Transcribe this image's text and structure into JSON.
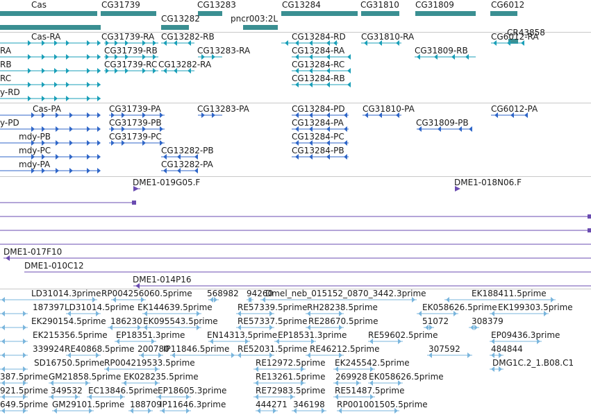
{
  "colors": {
    "gene": "#3a8f92",
    "mrna": "#1a9fb8",
    "protein": "#2f66c8",
    "clone": "#6a4bb0",
    "est": "#7ab6dd",
    "separator": "#c8c8c8"
  },
  "genes_track": {
    "features": [
      {
        "label": "Cas",
        "style": "gene"
      },
      {
        "label": "CG31739",
        "style": "gene"
      },
      {
        "label": "CG13283",
        "style": "gene"
      },
      {
        "label": "CG13284",
        "style": "gene"
      },
      {
        "label": "CG31810",
        "style": "gene"
      },
      {
        "label": "CG31809",
        "style": "gene"
      },
      {
        "label": "CG6012",
        "style": "gene"
      },
      {
        "label": "CG13282",
        "style": "gene"
      },
      {
        "label": "pncr003:2L",
        "style": "gene"
      },
      {
        "label": "CR43858",
        "style": "gene"
      },
      {
        "label": "",
        "style": "gene"
      }
    ]
  },
  "transcripts_track": {
    "features": [
      {
        "label": "Cas-RA",
        "style": "mrna"
      },
      {
        "label": "CG31739-RA",
        "style": "mrna"
      },
      {
        "label": "CG13282-RB",
        "style": "mrna"
      },
      {
        "label": "CG13284-RD",
        "style": "mrna"
      },
      {
        "label": "CG31810-RA",
        "style": "mrna"
      },
      {
        "label": "CG6012-RA",
        "style": "mrna"
      },
      {
        "label": "RA",
        "style": "mrna"
      },
      {
        "label": "CG31739-RB",
        "style": "mrna"
      },
      {
        "label": "CG13283-RA",
        "style": "mrna"
      },
      {
        "label": "CG13284-RA",
        "style": "mrna"
      },
      {
        "label": "CG31809-RB",
        "style": "mrna"
      },
      {
        "label": "RB",
        "style": "mrna"
      },
      {
        "label": "CG31739-RC",
        "style": "mrna"
      },
      {
        "label": "CG13282-RA",
        "style": "mrna"
      },
      {
        "label": "CG13284-RC",
        "style": "mrna"
      },
      {
        "label": "RC",
        "style": "mrna"
      },
      {
        "label": "CG13284-RB",
        "style": "mrna"
      },
      {
        "label": "y-RD",
        "style": "mrna"
      }
    ]
  },
  "proteins_track": {
    "features": [
      {
        "label": "Cas-PA",
        "style": "protein"
      },
      {
        "label": "CG31739-PA",
        "style": "protein"
      },
      {
        "label": "CG13283-PA",
        "style": "protein"
      },
      {
        "label": "CG13284-PD",
        "style": "protein"
      },
      {
        "label": "CG31810-PA",
        "style": "protein"
      },
      {
        "label": "CG6012-PA",
        "style": "protein"
      },
      {
        "label": "y-PD",
        "style": "protein"
      },
      {
        "label": "CG31739-PB",
        "style": "protein"
      },
      {
        "label": "CG13284-PA",
        "style": "protein"
      },
      {
        "label": "CG31809-PB",
        "style": "protein"
      },
      {
        "label": "mdy-PB",
        "style": "protein"
      },
      {
        "label": "CG31739-PC",
        "style": "protein"
      },
      {
        "label": "CG13284-PC",
        "style": "protein"
      },
      {
        "label": "mdy-PC",
        "style": "protein"
      },
      {
        "label": "CG13282-PB",
        "style": "protein"
      },
      {
        "label": "CG13284-PB",
        "style": "protein"
      },
      {
        "label": "mdy-PA",
        "style": "protein"
      },
      {
        "label": "CG13282-PA",
        "style": "protein"
      }
    ]
  },
  "clones_track": {
    "features": [
      {
        "label": "DME1-019G05.F",
        "style": "clone"
      },
      {
        "label": "DME1-018N06.F",
        "style": "clone"
      },
      {
        "label": "",
        "style": "clone"
      },
      {
        "label": "",
        "style": "clone"
      },
      {
        "label": "",
        "style": "clone"
      },
      {
        "label": "",
        "style": "clone"
      },
      {
        "label": "DME1-017F10",
        "style": "clone"
      },
      {
        "label": "DME1-010C12",
        "style": "clone"
      },
      {
        "label": "DME1-014P16",
        "style": "clone"
      }
    ]
  },
  "est_track": {
    "features": [
      {
        "label": "LD31014.3prime",
        "style": "est"
      },
      {
        "label": "RP004256060.5prime",
        "style": "est"
      },
      {
        "label": "568982",
        "style": "est"
      },
      {
        "label": "94260",
        "style": "est"
      },
      {
        "label": "Dmel_neb_015152_0870_3442.3prime",
        "style": "est"
      },
      {
        "label": "EK188411.5prime",
        "style": "est"
      },
      {
        "label": "187397",
        "style": "est"
      },
      {
        "label": "LD31014.5prime",
        "style": "est"
      },
      {
        "label": "EK144639.5prime",
        "style": "est"
      },
      {
        "label": "RE57339.5prime",
        "style": "est"
      },
      {
        "label": "RH28238.5prime",
        "style": "est"
      },
      {
        "label": "EK058626.5prime",
        "style": "est"
      },
      {
        "label": "EK199303.5prime",
        "style": "est"
      },
      {
        "label": "EK290154.5prime",
        "style": "est"
      },
      {
        "label": "186230",
        "style": "est"
      },
      {
        "label": "EK095543.5prime",
        "style": "est"
      },
      {
        "label": "RE57337.5prime",
        "style": "est"
      },
      {
        "label": "RE28670.5prime",
        "style": "est"
      },
      {
        "label": "51072",
        "style": "est"
      },
      {
        "label": "308379",
        "style": "est"
      },
      {
        "label": "EK215356.5prime",
        "style": "est"
      },
      {
        "label": "EP18351.3prime",
        "style": "est"
      },
      {
        "label": "EN14313.5prime",
        "style": "est"
      },
      {
        "label": "EP18531.3prime",
        "style": "est"
      },
      {
        "label": "RE59602.5prime",
        "style": "est"
      },
      {
        "label": "EP09436.3prime",
        "style": "est"
      },
      {
        "label": "339924",
        "style": "est"
      },
      {
        "label": "RE40868.5prime",
        "style": "est"
      },
      {
        "label": "200780",
        "style": "est"
      },
      {
        "label": "IP11846.5prime",
        "style": "est"
      },
      {
        "label": "RE52031.5prime",
        "style": "est"
      },
      {
        "label": "RE46212.5prime",
        "style": "est"
      },
      {
        "label": "307592",
        "style": "est"
      },
      {
        "label": "484844",
        "style": "est"
      },
      {
        "label": "SD16750.5prime",
        "style": "est"
      },
      {
        "label": "RP004219533.5prime",
        "style": "est"
      },
      {
        "label": "RE12972.5prime",
        "style": "est"
      },
      {
        "label": "EK245542.5prime",
        "style": "est"
      },
      {
        "label": "DMG1C.2_1.B08.C1",
        "style": "est"
      },
      {
        "label": "387.5prime",
        "style": "est"
      },
      {
        "label": "GM21858.5prime",
        "style": "est"
      },
      {
        "label": "EK028235.5prime",
        "style": "est"
      },
      {
        "label": "RE13261.5prime",
        "style": "est"
      },
      {
        "label": "269928",
        "style": "est"
      },
      {
        "label": "EK058626.5prime",
        "style": "est"
      },
      {
        "label": "921.5prime",
        "style": "est"
      },
      {
        "label": "349532",
        "style": "est"
      },
      {
        "label": "EC13846.5prime",
        "style": "est"
      },
      {
        "label": "EP18605.3prime",
        "style": "est"
      },
      {
        "label": "RE72983.5prime",
        "style": "est"
      },
      {
        "label": "RE51487.5prime",
        "style": "est"
      },
      {
        "label": "649.5prime",
        "style": "est"
      },
      {
        "label": "GM29101.5prime",
        "style": "est"
      },
      {
        "label": "188709",
        "style": "est"
      },
      {
        "label": "IP11646.3prime",
        "style": "est"
      },
      {
        "label": "444271",
        "style": "est"
      },
      {
        "label": "346198",
        "style": "est"
      },
      {
        "label": "RP001001505.5prime",
        "style": "est"
      }
    ]
  }
}
